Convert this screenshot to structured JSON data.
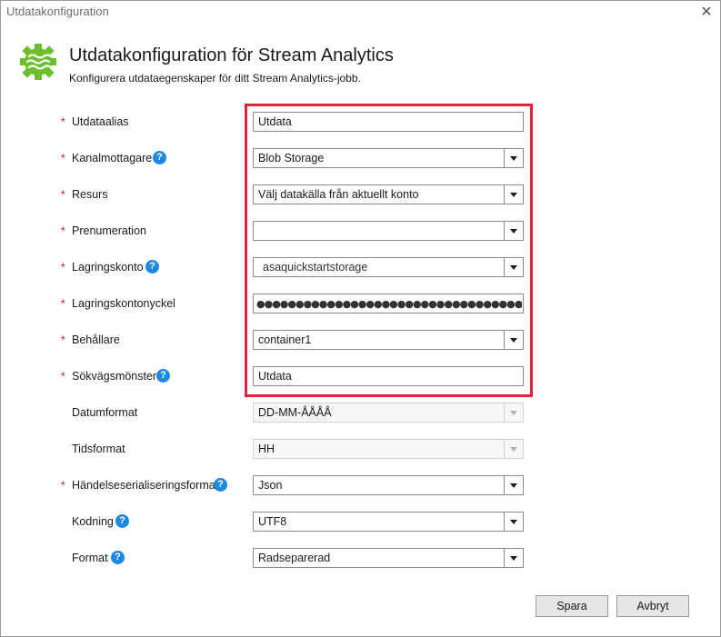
{
  "window": {
    "title": "Utdatakonfiguration",
    "close_glyph": "✕"
  },
  "header": {
    "icon": "stream-analytics-gear-icon",
    "title": "Utdatakonfiguration för Stream Analytics",
    "subtitle": "Konfigurera utdataegenskaper för ditt Stream Analytics-jobb."
  },
  "form": {
    "required_mark": "*",
    "help_glyph": "?",
    "fields": [
      {
        "label": "Utdataalias",
        "value": "Utdata",
        "type": "text"
      },
      {
        "label": "Kanalmottagare",
        "value": "Blob Storage",
        "type": "select"
      },
      {
        "label": "Resurs",
        "value": "Välj datakälla från aktuellt konto",
        "type": "select"
      },
      {
        "label": "Prenumeration",
        "value": "",
        "type": "select"
      },
      {
        "label": "Lagringskonto",
        "value": "asaquickstartstorage",
        "type": "select"
      },
      {
        "label": "Lagringskontonyckel",
        "value": "●●●●●●●●●●●●●●●●●●●●●●●●●●●●●●●●●●●●●●●●●●●●",
        "type": "password"
      },
      {
        "label": "Behållare",
        "value": "container1",
        "type": "select"
      },
      {
        "label": "Sökvägsmönster",
        "value": "Utdata",
        "type": "text"
      },
      {
        "label": "Datumformat",
        "value": "DD-MM-ÅÅÅÅ",
        "type": "select"
      },
      {
        "label": "Tidsformat",
        "value": "HH",
        "type": "select"
      },
      {
        "label": "Händelseserialiseringsformat",
        "value": "Json",
        "type": "select"
      },
      {
        "label": "Kodning",
        "value": "UTF8",
        "type": "select"
      },
      {
        "label": "Format",
        "value": "Radseparerad",
        "type": "select"
      }
    ]
  },
  "buttons": {
    "save": "Spara",
    "cancel": "Avbryt"
  },
  "colors": {
    "required": "#c4141a",
    "help": "#1e88e5",
    "highlight": "#e0223c",
    "icon": "#6cbf2d"
  }
}
